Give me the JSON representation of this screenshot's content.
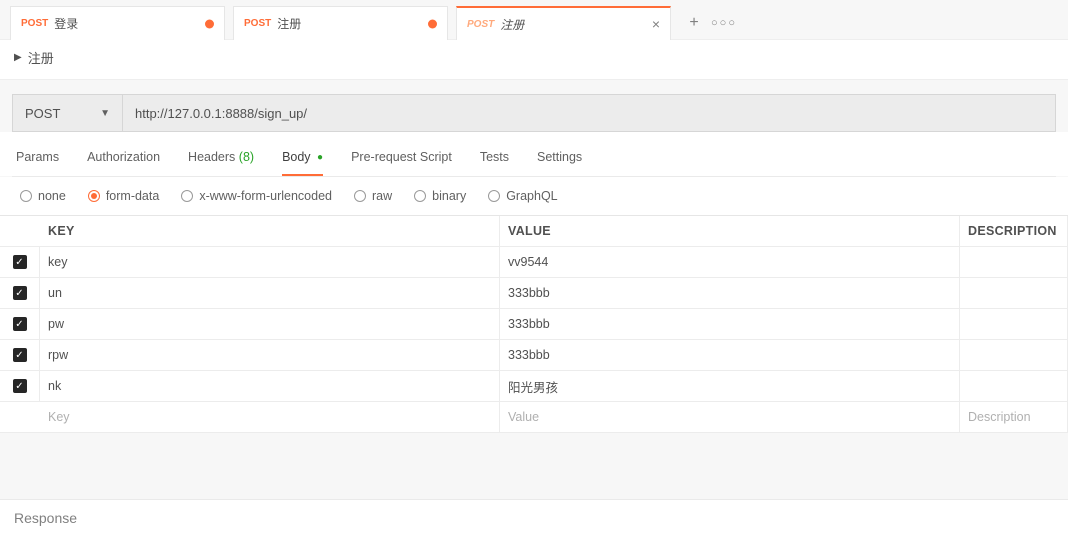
{
  "tabs": [
    {
      "method": "POST",
      "title": "登录",
      "dirty": true
    },
    {
      "method": "POST",
      "title": "注册",
      "dirty": true
    },
    {
      "method": "POST",
      "title": "注册",
      "dirty": false
    }
  ],
  "breadcrumb": {
    "title": "注册"
  },
  "request": {
    "method": "POST",
    "url": "http://127.0.0.1:8888/sign_up/"
  },
  "subtabs": {
    "params": "Params",
    "authorization": "Authorization",
    "headers": "Headers",
    "headers_count": "(8)",
    "body": "Body",
    "prerequest": "Pre-request Script",
    "tests": "Tests",
    "settings": "Settings"
  },
  "body_types": {
    "none": "none",
    "form_data": "form-data",
    "urlencoded": "x-www-form-urlencoded",
    "raw": "raw",
    "binary": "binary",
    "graphql": "GraphQL"
  },
  "form_headers": {
    "key": "KEY",
    "value": "VALUE",
    "desc": "DESCRIPTION"
  },
  "form_rows": [
    {
      "key": "key",
      "value": "vv9544"
    },
    {
      "key": "un",
      "value": "333bbb"
    },
    {
      "key": "pw",
      "value": "333bbb"
    },
    {
      "key": "rpw",
      "value": "333bbb"
    },
    {
      "key": "nk",
      "value": "阳光男孩"
    }
  ],
  "form_placeholder": {
    "key": "Key",
    "value": "Value",
    "desc": "Description"
  },
  "response": {
    "label": "Response"
  }
}
